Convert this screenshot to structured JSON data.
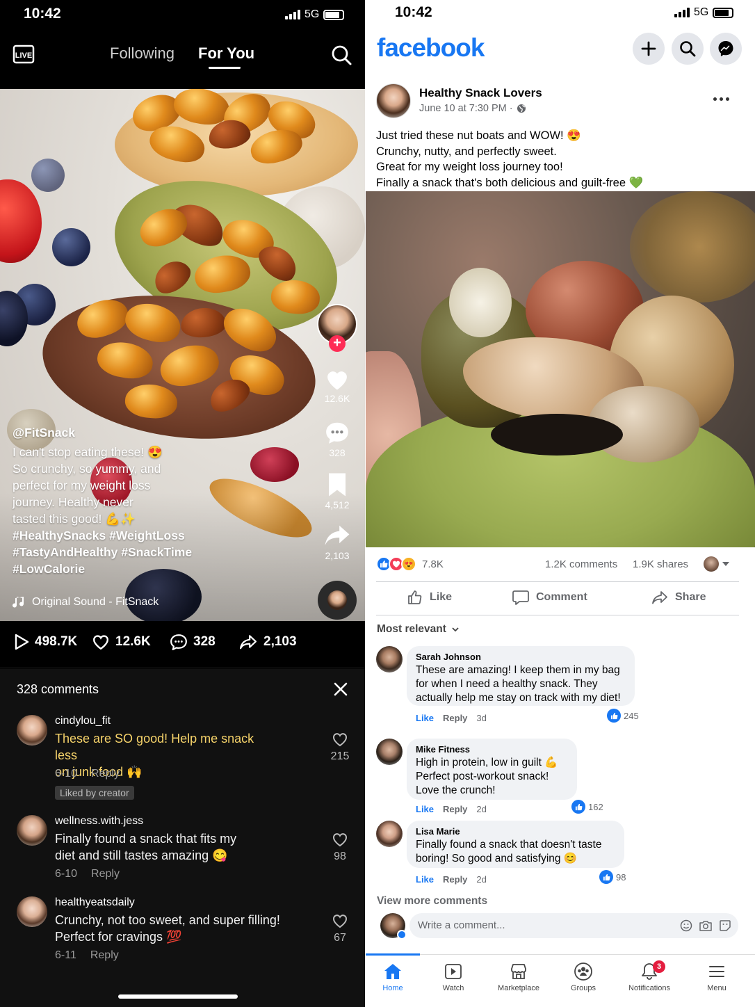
{
  "tiktok": {
    "status": {
      "time": "10:42",
      "network": "5G"
    },
    "tabs": {
      "following": "Following",
      "for_you": "For You"
    },
    "caption": {
      "username": "@FitSnack",
      "lines": [
        "I can't stop eating these! 😍",
        "So crunchy, so yummy, and",
        "perfect for my weight loss",
        "journey. Healthy never",
        "tasted this good! 💪✨"
      ],
      "hashtags": [
        "#HealthySnacks #WeightLoss",
        "#TastyAndHealthy #SnackTime",
        "#LowCalorie"
      ]
    },
    "sound": "Original Sound - FitSnack",
    "side": {
      "likes": "12.6K",
      "comments": "328",
      "saves": "4,512",
      "shares": "2,103"
    },
    "stats": {
      "plays": "498.7K",
      "likes": "12.6K",
      "comments": "328",
      "shares": "2,103"
    },
    "comments_header": "328 comments",
    "comments": [
      {
        "user": "cindylou_fit",
        "text": "These are SO good! Help me snack less",
        "text2": "on junk food 🙌",
        "date": "6-10",
        "reply": "Reply",
        "likes": "215",
        "badge": "Liked by creator"
      },
      {
        "user": "wellness.with.jess",
        "text": "Finally found a snack that fits my",
        "text2": "diet and still tastes amazing 😋",
        "date": "6-10",
        "reply": "Reply",
        "likes": "98"
      },
      {
        "user": "healthyeatsdaily",
        "text": "Crunchy, not too sweet, and super filling!",
        "text2": "Perfect for cravings 💯",
        "date": "6-11",
        "reply": "Reply",
        "likes": "67"
      }
    ]
  },
  "facebook": {
    "status": {
      "time": "10:42",
      "network": "5G"
    },
    "logo": "facebook",
    "post": {
      "author": "Healthy Snack Lovers",
      "time": "June 10 at 7:30 PM ·",
      "lines": [
        "Just tried these nut boats and WOW! 😍",
        "Crunchy, nutty, and perfectly sweet.",
        "Great for my weight loss journey too!",
        "Finally a snack that's both delicious and guilt-free 💚"
      ]
    },
    "reactions": {
      "count": "7.8K",
      "comments": "1.2K comments",
      "shares": "1.9K shares"
    },
    "actions": {
      "like": "Like",
      "comment": "Comment",
      "share": "Share"
    },
    "sort": "Most relevant",
    "comments": [
      {
        "name": "Sarah Johnson",
        "lines": [
          "These are amazing! I keep them in my bag",
          "for when I need a healthy snack. They",
          "actually help me stay on track with my diet!"
        ],
        "like": "Like",
        "reply": "Reply",
        "time": "3d",
        "reacts": "245"
      },
      {
        "name": "Mike Fitness",
        "lines": [
          "High in protein, low in guilt 💪",
          "Perfect post-workout snack!",
          "Love the crunch!"
        ],
        "like": "Like",
        "reply": "Reply",
        "time": "2d",
        "reacts": "162"
      },
      {
        "name": "Lisa Marie",
        "lines": [
          "Finally found a snack that doesn't taste",
          "boring! So good and satisfying 😊"
        ],
        "like": "Like",
        "reply": "Reply",
        "time": "2d",
        "reacts": "98"
      }
    ],
    "view_more": "View more comments",
    "write_placeholder": "Write a comment...",
    "nav": {
      "home": "Home",
      "watch": "Watch",
      "marketplace": "Marketplace",
      "groups": "Groups",
      "notifications": "Notifications",
      "menu": "Menu",
      "notif_badge": "3"
    }
  },
  "colors": {
    "fb_blue": "#1877f2",
    "tt_red": "#fe2c55",
    "gold": "#f6d36a"
  }
}
